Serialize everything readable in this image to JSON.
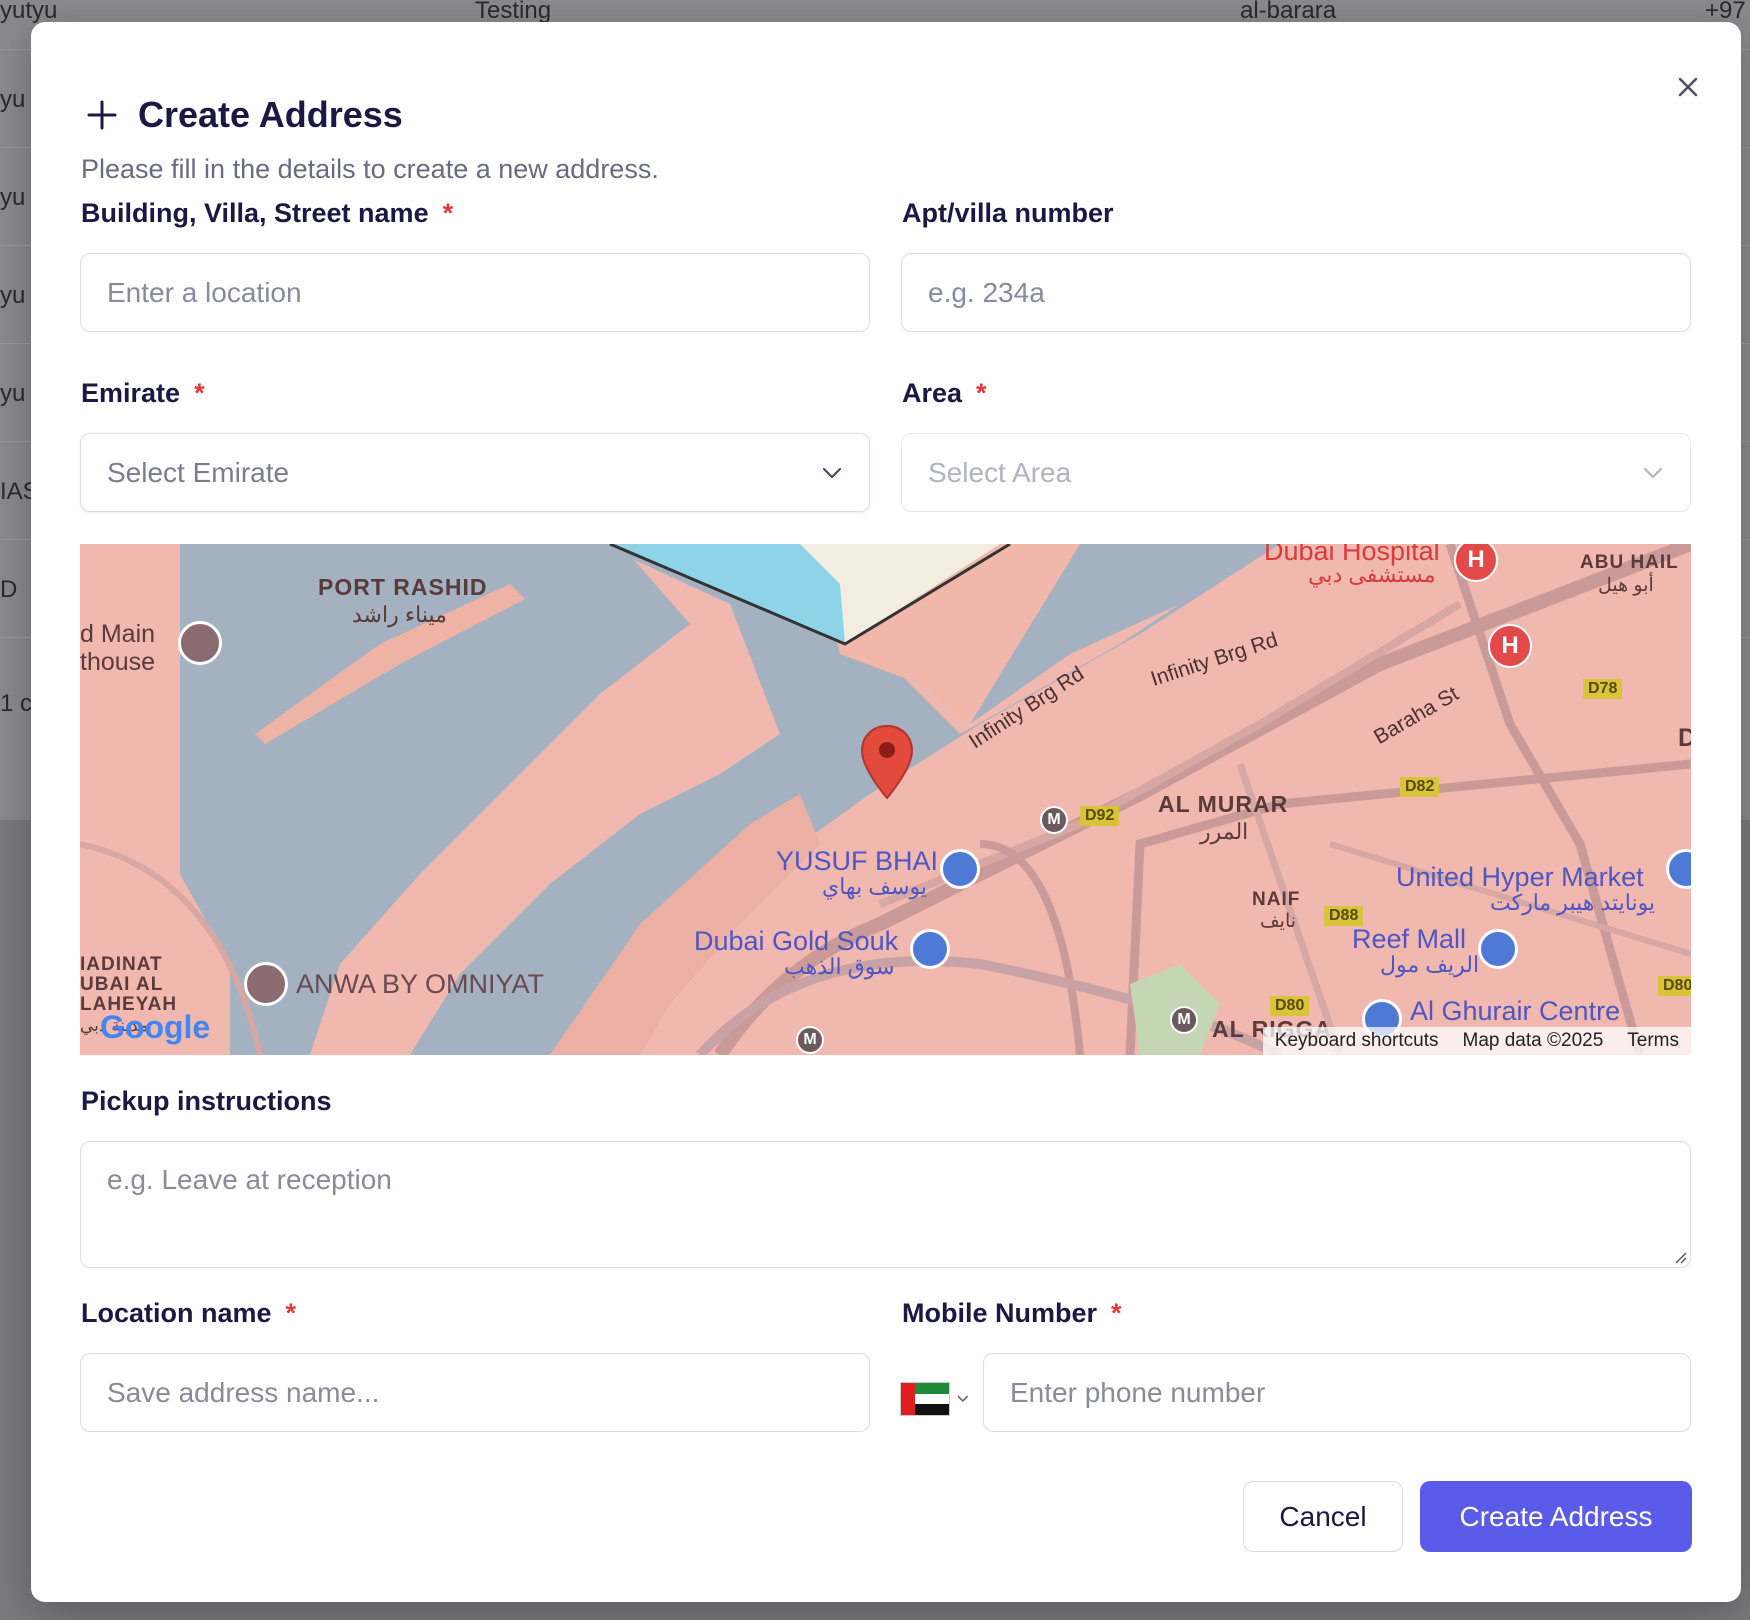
{
  "background_table": {
    "rows": [
      {
        "c1": "yutyu",
        "c2": "Testing",
        "c3": "al-barara",
        "c4": "+97"
      },
      {
        "c1": "yu"
      },
      {
        "c1": "yu"
      },
      {
        "c1": "yu"
      },
      {
        "c1": "yu"
      },
      {
        "c1": "IAS"
      },
      {
        "c1": "D"
      }
    ],
    "pagination_hint": "1 c"
  },
  "modal": {
    "title": "Create Address",
    "subtitle": "Please fill in the details to create a new address."
  },
  "form": {
    "street": {
      "label": "Building, Villa, Street name",
      "required_mark": "*",
      "placeholder": "Enter a location"
    },
    "apt": {
      "label": "Apt/villa number",
      "placeholder": "e.g. 234a"
    },
    "emirate": {
      "label": "Emirate",
      "required_mark": "*",
      "placeholder": "Select Emirate"
    },
    "area": {
      "label": "Area",
      "required_mark": "*",
      "placeholder": "Select Area",
      "disabled": true
    },
    "pickup": {
      "label": "Pickup instructions",
      "placeholder": "e.g. Leave at reception"
    },
    "location_name": {
      "label": "Location name",
      "required_mark": "*",
      "placeholder": "Save address name..."
    },
    "mobile": {
      "label": "Mobile Number",
      "required_mark": "*",
      "placeholder": "Enter phone number",
      "country": "AE"
    }
  },
  "map": {
    "labels": {
      "port_rashid": "PORT RASHID",
      "port_rashid_ar": "ميناء راشد",
      "main_lighthouse_1": "d Main",
      "main_lighthouse_2": "thouse",
      "dubai_hospital": "Dubai Hospital",
      "dubai_hospital_ar": "مستشفى دبي",
      "abu_hail": "ABU HAIL",
      "abu_hail_ar": "أبو هيل",
      "infinity_1": "Infinity Brg Rd",
      "infinity_2": "Infinity Brg Rd",
      "baraha_st": "Baraha St",
      "d78": "D78",
      "deira": "DE",
      "al_murar": "AL MURAR",
      "al_murar_ar": "المرر",
      "d82": "D82",
      "d92": "D92",
      "yusuf_bhai": "YUSUF BHAI",
      "yusuf_bhai_ar": "يوسف بهاي",
      "united_hyper": "United Hyper Market",
      "united_hyper_ar": "يونايتد هيبر ماركت",
      "naif": "NAIF",
      "naif_ar": "نايف",
      "d88": "D88",
      "gold_souk": "Dubai Gold Souk",
      "gold_souk_ar": "سوق الذهب",
      "reef_mall": "Reef Mall",
      "reef_mall_ar": "الريف مول",
      "d80a": "D80",
      "d80b": "D80",
      "madinat_1": "IADINAT",
      "madinat_2": "UBAI AL",
      "madinat_3": "LAHEYAH",
      "madinat_ar": "مدينة دبي",
      "anwa": "ANWA BY OMNIYAT",
      "al_ghurair": "Al Ghurair Centre",
      "al_rigga": "AL RIGGA",
      "google": "Google"
    },
    "attribution": {
      "shortcuts": "Keyboard shortcuts",
      "data": "Map data ©2025",
      "terms": "Terms"
    }
  },
  "actions": {
    "cancel": "Cancel",
    "create": "Create Address"
  },
  "colors": {
    "primary": "#5b5bea",
    "required": "#e33838",
    "title": "#1b1843"
  }
}
